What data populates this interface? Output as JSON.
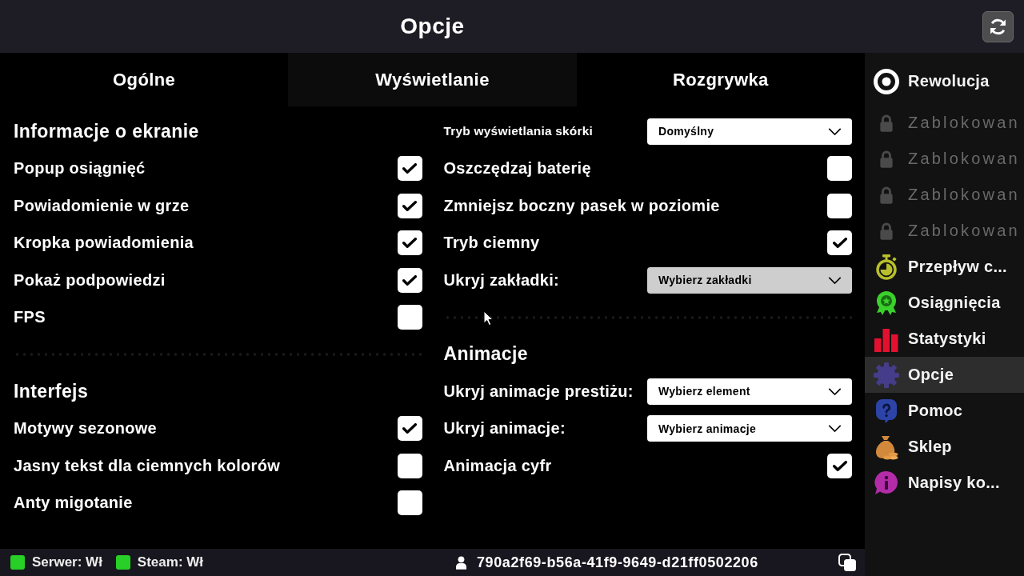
{
  "header": {
    "title": "Opcje"
  },
  "tabs": [
    {
      "label": "Ogólne",
      "selected": false
    },
    {
      "label": "Wyświetlanie",
      "selected": true
    },
    {
      "label": "Rozgrywka",
      "selected": false
    }
  ],
  "columns": [
    {
      "sections": [
        {
          "heading": "Informacje o ekranie",
          "rows": [
            {
              "kind": "checkbox",
              "label": "Popup osiągnięć",
              "checked": true
            },
            {
              "kind": "checkbox",
              "label": "Powiadomienie w grze",
              "checked": true
            },
            {
              "kind": "checkbox",
              "label": "Kropka powiadomienia",
              "checked": true
            },
            {
              "kind": "checkbox",
              "label": "Pokaż podpowiedzi",
              "checked": true
            },
            {
              "kind": "checkbox",
              "label": "FPS",
              "checked": false
            }
          ]
        },
        {
          "heading": "Interfejs",
          "rows": [
            {
              "kind": "checkbox",
              "label": "Motywy sezonowe",
              "checked": true
            },
            {
              "kind": "checkbox",
              "label": "Jasny tekst dla ciemnych kolorów",
              "checked": false
            },
            {
              "kind": "checkbox",
              "label": "Anty migotanie",
              "checked": false
            }
          ]
        }
      ]
    },
    {
      "sections": [
        {
          "rows": [
            {
              "kind": "compact",
              "label": "Tryb wyświetlania skórki",
              "value": "Domyślny",
              "disabled": false
            },
            {
              "kind": "checkbox",
              "label": "Oszczędzaj baterię",
              "checked": false
            },
            {
              "kind": "checkbox",
              "label": "Zmniejsz boczny pasek w poziomie",
              "checked": false
            },
            {
              "kind": "checkbox",
              "label": "Tryb ciemny",
              "checked": true
            },
            {
              "kind": "dropdown",
              "label": "Ukryj zakładki:",
              "placeholder": "Wybierz zakładki",
              "disabled": true
            }
          ]
        },
        {
          "heading": "Animacje",
          "rows": [
            {
              "kind": "dropdown",
              "label": "Ukryj animacje prestiżu:",
              "placeholder": "Wybierz element",
              "disabled": false
            },
            {
              "kind": "dropdown",
              "label": "Ukryj animacje:",
              "placeholder": "Wybierz animacje",
              "disabled": false
            },
            {
              "kind": "checkbox",
              "label": "Animacja cyfr",
              "checked": true
            }
          ]
        }
      ]
    }
  ],
  "sidebar": {
    "items": [
      {
        "label": "Rewolucja",
        "selected": false,
        "locked": false
      },
      {
        "label": "Zablokowan",
        "selected": false,
        "locked": true
      },
      {
        "label": "Zablokowan",
        "selected": false,
        "locked": true
      },
      {
        "label": "Zablokowan",
        "selected": false,
        "locked": true
      },
      {
        "label": "Zablokowan",
        "selected": false,
        "locked": true
      },
      {
        "label": "Przepływ c...",
        "selected": false,
        "locked": false
      },
      {
        "label": "Osiągnięcia",
        "selected": false,
        "locked": false
      },
      {
        "label": "Statystyki",
        "selected": false,
        "locked": false
      },
      {
        "label": "Opcje",
        "selected": true,
        "locked": false
      },
      {
        "label": "Pomoc",
        "selected": false,
        "locked": false
      },
      {
        "label": "Sklep",
        "selected": false,
        "locked": false
      },
      {
        "label": "Napisy ko...",
        "selected": false,
        "locked": false
      }
    ]
  },
  "status_bar": {
    "indicators": [
      {
        "label": "Serwer: Wł",
        "on": true
      },
      {
        "label": "Steam: Wł",
        "on": true
      }
    ],
    "user_id": "790a2f69-b56a-41f9-9649-d21ff0502206"
  }
}
